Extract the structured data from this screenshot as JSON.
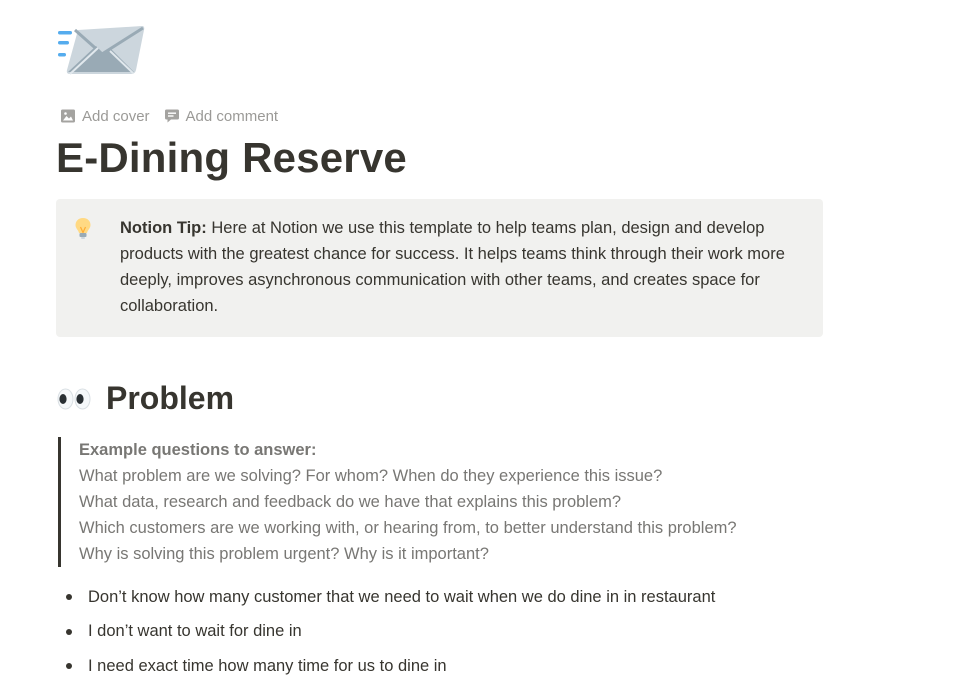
{
  "page": {
    "icon": "incoming-envelope-icon",
    "title": "E-Dining Reserve"
  },
  "actions": {
    "add_cover": "Add cover",
    "add_comment": "Add comment"
  },
  "callout": {
    "icon": "light-bulb-icon",
    "label": "Notion Tip:",
    "text": " Here at Notion we use this template to help teams plan, design and develop products with the greatest chance for success. It helps teams think through their work more deeply, improves asynchronous communication with other teams, and creates space for collaboration."
  },
  "problem": {
    "icon": "eyes-icon",
    "heading": "Problem",
    "quote": {
      "title": "Example questions to answer:",
      "lines": [
        "What problem are we solving? For whom? When do they experience this issue?",
        "What data, research and feedback do we have that explains this problem?",
        "Which customers are we working with, or hearing from, to better understand this problem?",
        "Why is solving this problem urgent? Why is it important?"
      ]
    },
    "bullets": [
      "Don’t know how many customer that we need to wait when we do dine in in restaurant",
      "I don’t want to wait for dine in",
      "I need exact time how many time for us to dine in"
    ]
  },
  "colors": {
    "text": "#37352f",
    "muted": "#9b9a97",
    "quote_text": "#787774",
    "callout_bg": "#f1f1ef"
  }
}
